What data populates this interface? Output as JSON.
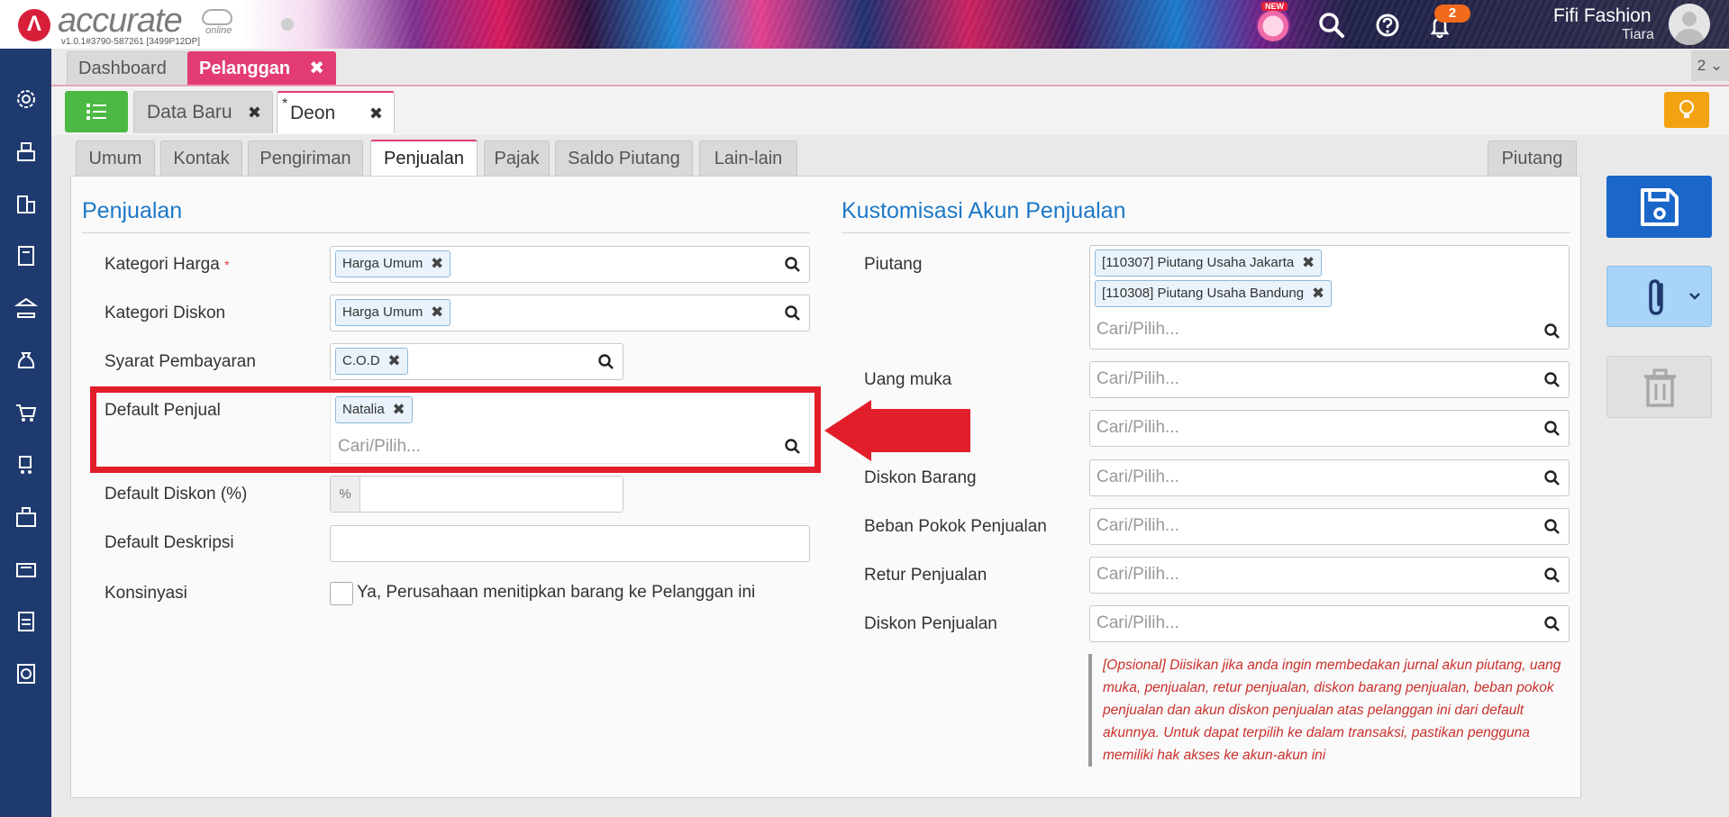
{
  "header": {
    "brand": "accurate",
    "brand_sub": "online",
    "version": "v1.0.1#3790-587261 [3499P12DP]",
    "new_badge": "NEW",
    "notification_count": "2",
    "user_name": "Fifi Fashion",
    "user_role": "Tiara"
  },
  "top_tabs": {
    "dashboard": "Dashboard",
    "pelanggan": "Pelanggan",
    "close_glyph": "✖",
    "count": "2 ⌄"
  },
  "sub_tabs": {
    "data_baru": "Data Baru",
    "deon": "Deon",
    "asterisk": "*"
  },
  "form_tabs": [
    "Umum",
    "Kontak",
    "Pengiriman",
    "Penjualan",
    "Pajak",
    "Saldo Piutang",
    "Lain-lain"
  ],
  "piutang_tab": "Piutang",
  "left_section": {
    "title": "Penjualan",
    "kategori_harga_label": "Kategori Harga",
    "required_mark": "*",
    "kategori_harga_chip": "Harga Umum",
    "kategori_diskon_label": "Kategori Diskon",
    "kategori_diskon_chip": "Harga Umum",
    "syarat_label": "Syarat Pembayaran",
    "syarat_chip": "C.O.D",
    "penjual_label": "Default Penjual",
    "penjual_chip": "Natalia",
    "penjual_placeholder": "Cari/Pilih...",
    "diskon_label": "Default Diskon (%)",
    "diskon_prefix": "%",
    "deskripsi_label": "Default Deskripsi",
    "konsinyasi_label": "Konsinyasi",
    "konsinyasi_text": "Ya, Perusahaan menitipkan barang ke Pelanggan ini"
  },
  "right_section": {
    "title": "Kustomisasi Akun Penjualan",
    "piutang_label": "Piutang",
    "piutang_chip_1": "[110307] Piutang Usaha Jakarta",
    "piutang_chip_2": "[110308] Piutang Usaha Bandung",
    "uang_muka_label": "Uang muka",
    "diskon_barang_label": "Diskon Barang",
    "beban_label": "Beban Pokok Penjualan",
    "retur_label": "Retur Penjualan",
    "diskon_penjualan_label": "Diskon Penjualan",
    "placeholder": "Cari/Pilih...",
    "note": "[Opsional] Diisikan jika anda ingin membedakan jurnal akun piutang, uang muka, penjualan, retur penjualan, diskon barang penjualan, beban pokok penjualan dan akun diskon penjualan atas pelanggan ini dari default akunnya. Untuk dapat terpilih ke dalam transaksi, pastikan pengguna memiliki hak akses ke akun-akun ini"
  },
  "colors": {
    "accent_pink": "#e23c73",
    "title_blue": "#1d78c6",
    "highlight_red": "#e31e2b",
    "sidebar": "#1f3a6e"
  }
}
